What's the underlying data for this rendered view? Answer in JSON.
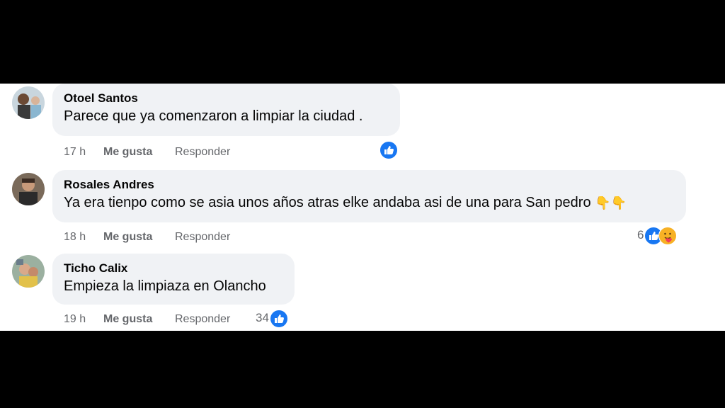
{
  "comments": [
    {
      "author": "Otoel Santos",
      "text": "Parece que ya comenzaron a limpiar la ciudad .",
      "emoji": "",
      "time": "17 h",
      "like_label": "Me gusta",
      "reply_label": "Responder",
      "reaction_count": "",
      "reactions": [
        "like-icon"
      ]
    },
    {
      "author": "Rosales Andres",
      "text": "Ya era tienpo como se asia unos años atras elke andaba asi de una para San pedro",
      "emoji": "👇👇",
      "time": "18 h",
      "like_label": "Me gusta",
      "reply_label": "Responder",
      "reaction_count": "6",
      "reactions": [
        "like-icon",
        "care-icon"
      ]
    },
    {
      "author": "Ticho Calix",
      "text": "Empieza la limpiaza en Olancho",
      "emoji": "",
      "time": "19 h",
      "like_label": "Me gusta",
      "reply_label": "Responder",
      "reaction_count": "34",
      "reactions": [
        "like-icon"
      ]
    }
  ],
  "colors": {
    "bubble": "#f0f2f5",
    "meta_text": "#65676b",
    "like_blue": "#1877f2"
  }
}
